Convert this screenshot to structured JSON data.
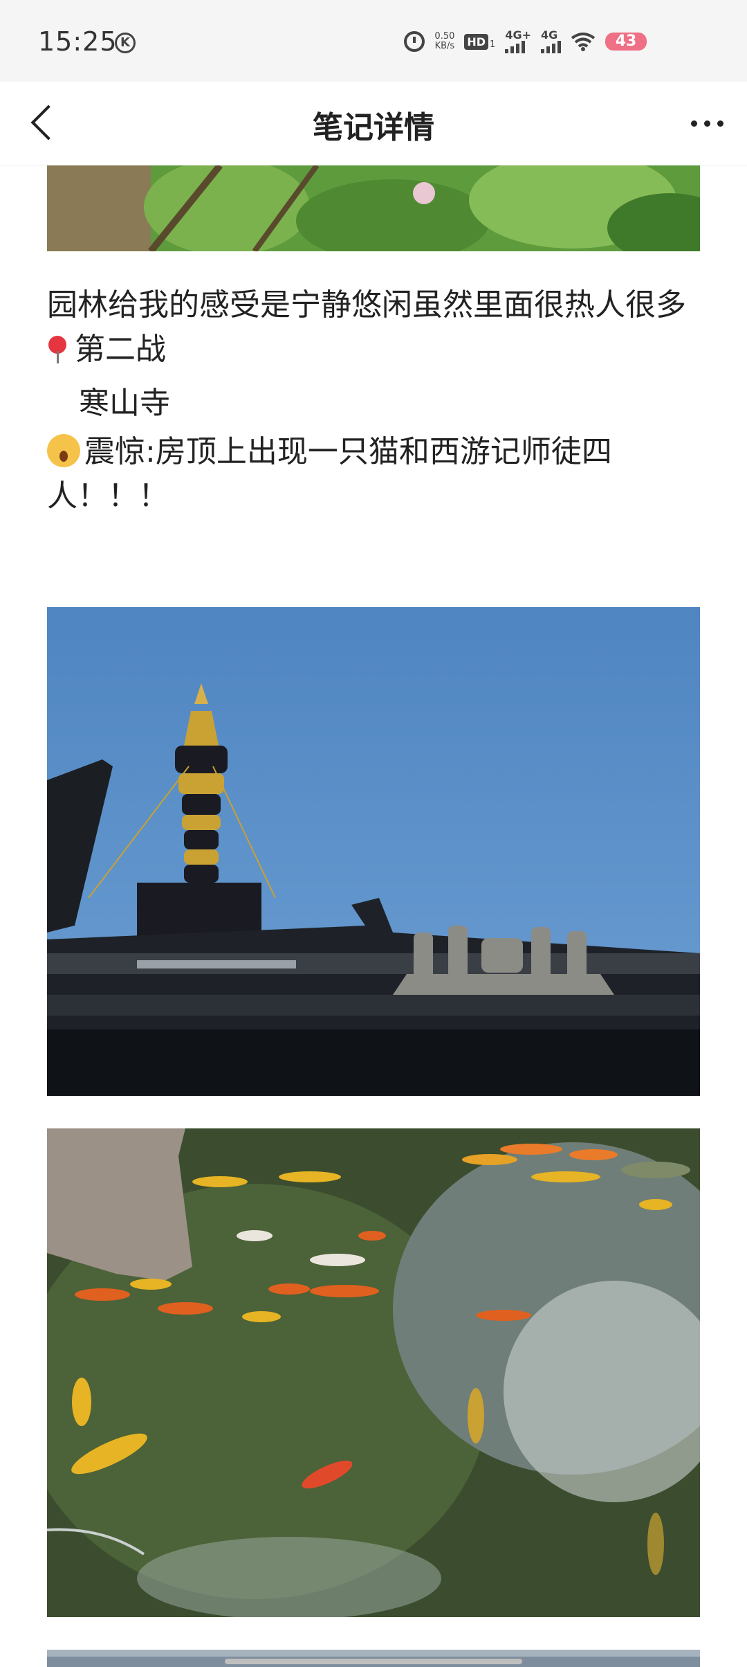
{
  "status_bar": {
    "time": "15:25",
    "k_icon": "K",
    "net_speed_value": "0.50",
    "net_speed_unit": "KB/s",
    "hd_label": "HD",
    "hd_sub": "1",
    "signal1_label": "4G+",
    "signal2_label": "4G",
    "battery": "43"
  },
  "nav": {
    "title": "笔记详情"
  },
  "post": {
    "paragraph1": "园林给我的感受是宁静悠闲虽然里面很热人很多",
    "pin_line": "第二战",
    "location_line": "寒山寺",
    "shock_line": "震惊:房顶上出现一只猫和西游记师徒四人！！！"
  },
  "colors": {
    "accent_battery": "#ef6f84",
    "text": "#222222",
    "sky": "#5b8fc7"
  }
}
